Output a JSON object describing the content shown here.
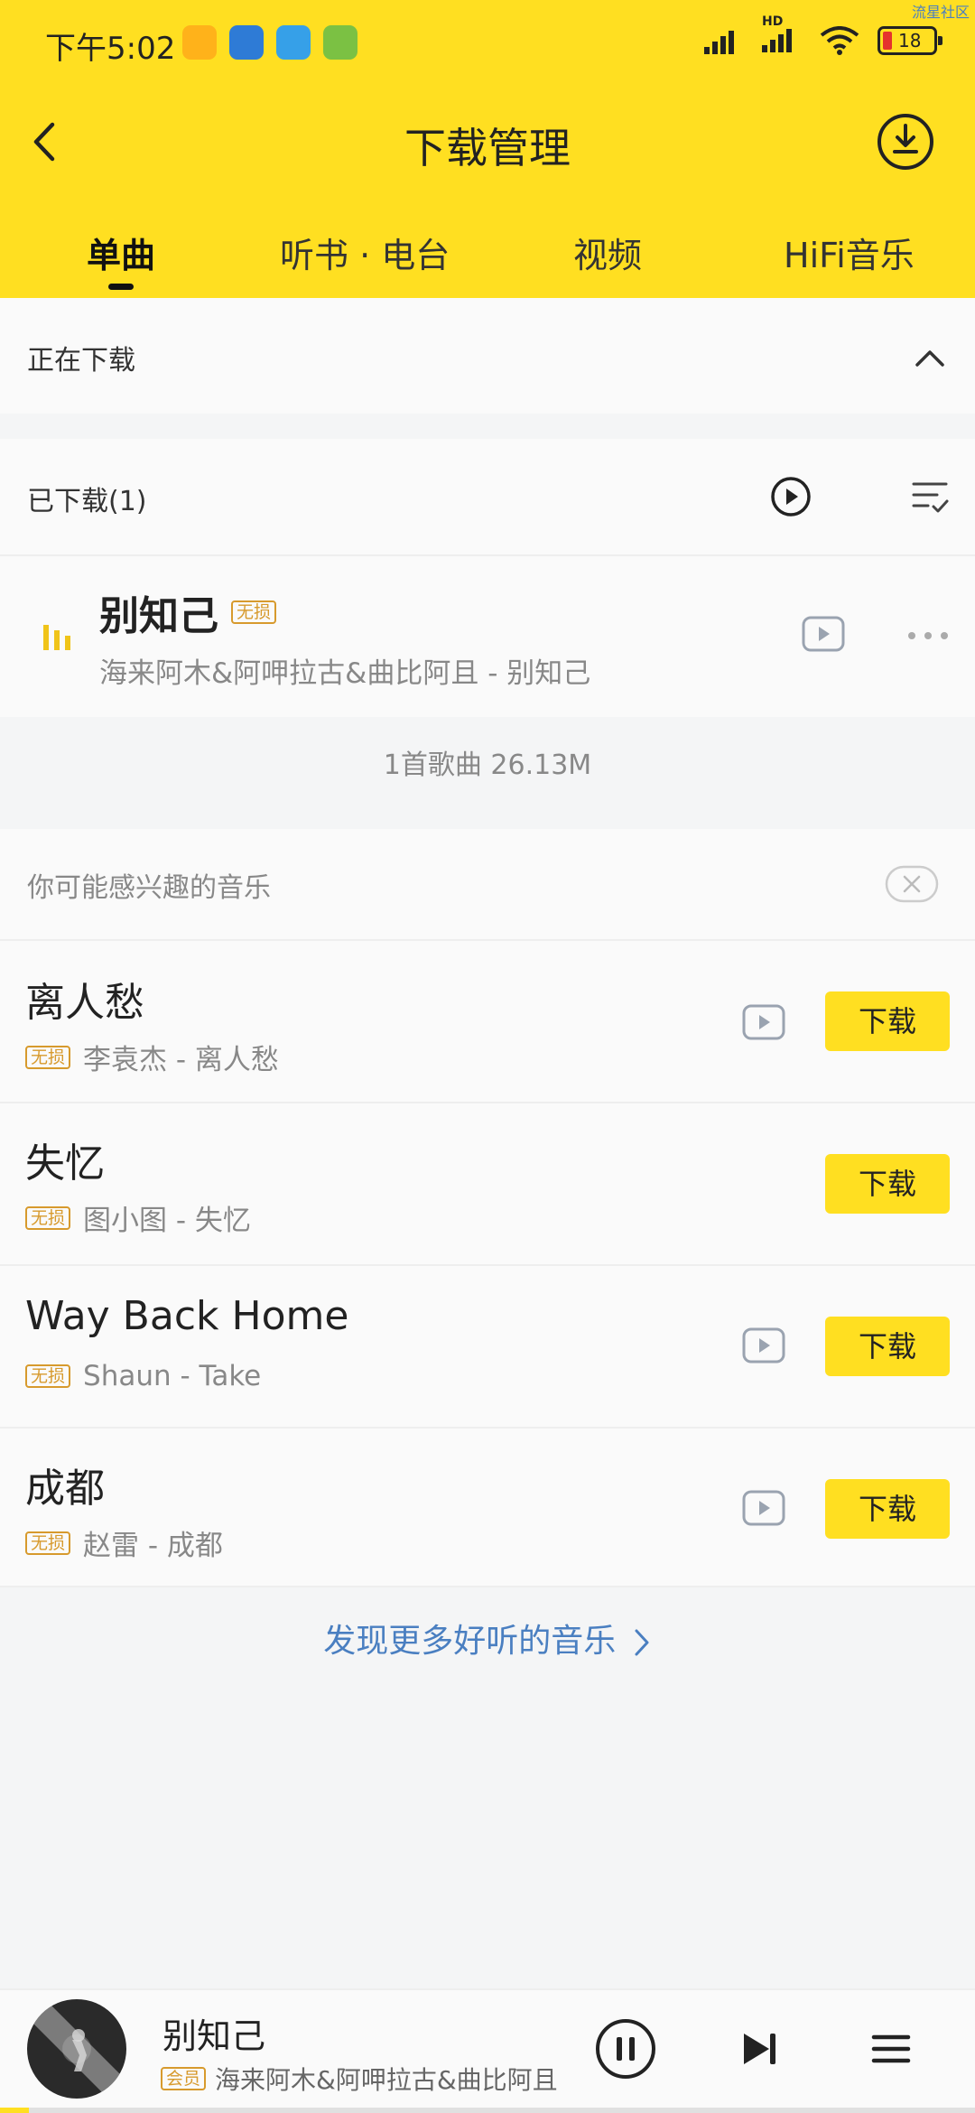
{
  "status": {
    "time": "下午5:02",
    "battery": "18",
    "network": "HD",
    "watermark": "流星社区"
  },
  "header": {
    "title": "下载管理"
  },
  "tabs": [
    {
      "label": "单曲"
    },
    {
      "label": "听书 · 电台"
    },
    {
      "label": "视频"
    },
    {
      "label": "HiFi音乐"
    }
  ],
  "downloading": {
    "label": "正在下载"
  },
  "downloaded": {
    "label": "已下载(1)",
    "song": {
      "name": "别知己",
      "quality": "无损",
      "artist": "海来阿木&阿呷拉古&曲比阿且 - 别知己"
    },
    "summary": "1首歌曲 26.13M"
  },
  "recommend": {
    "label": "你可能感兴趣的音乐",
    "download_label": "下载",
    "songs": [
      {
        "name": "离人愁",
        "quality": "无损",
        "artist": "李袁杰 - 离人愁"
      },
      {
        "name": "失忆",
        "quality": "无损",
        "artist": "图小图 - 失忆"
      },
      {
        "name": "Way Back Home",
        "quality": "无损",
        "artist": "Shaun - Take"
      },
      {
        "name": "成都",
        "quality": "无损",
        "artist": "赵雷 - 成都"
      }
    ],
    "more": "发现更多好听的音乐"
  },
  "player": {
    "name": "别知己",
    "vip": "会员",
    "artist": "海来阿木&阿呷拉古&曲比阿且",
    "progress": 0.03
  },
  "colors": {
    "accent": "#ffdf21",
    "quality_badge": "#d79a2d",
    "link": "#4a7fc1"
  }
}
